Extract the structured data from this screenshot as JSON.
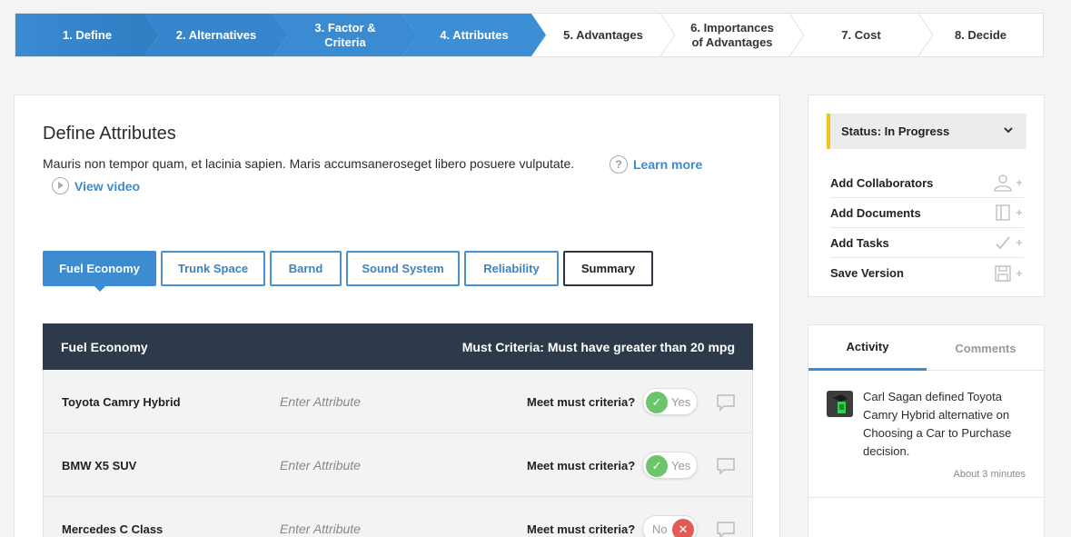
{
  "stepper": {
    "steps": [
      {
        "label": "1. Define",
        "state": "done"
      },
      {
        "label": "2. Alternatives",
        "state": "done"
      },
      {
        "label": "3. Factor &\nCriteria",
        "state": "done"
      },
      {
        "label": "4. Attributes",
        "state": "current"
      },
      {
        "label": "5. Advantages",
        "state": "todo"
      },
      {
        "label": "6. Importances\nof Advantages",
        "state": "todo"
      },
      {
        "label": "7. Cost",
        "state": "todo"
      },
      {
        "label": "8. Decide",
        "state": "todo"
      }
    ]
  },
  "main": {
    "title": "Define Attributes",
    "description": "Mauris non tempor quam, et lacinia sapien. Maris accumsaneroseget libero posuere vulputate.",
    "learn_more": "Learn more",
    "view_video": "View video",
    "tabs": [
      {
        "label": "Fuel Economy",
        "active": true
      },
      {
        "label": "Trunk Space",
        "active": false
      },
      {
        "label": "Barnd",
        "active": false
      },
      {
        "label": "Sound System",
        "active": false
      },
      {
        "label": "Reliability",
        "active": false
      },
      {
        "label": "Summary",
        "active": false
      }
    ],
    "table": {
      "factor": "Fuel Economy",
      "criteria": "Must Criteria: Must have greater than 20 mpg",
      "rows": [
        {
          "name": "Toyota Camry Hybrid",
          "placeholder": "Enter Attribute",
          "question": "Meet must criteria?",
          "toggle": "Yes",
          "state": "yes"
        },
        {
          "name": "BMW X5 SUV",
          "placeholder": "Enter Attribute",
          "question": "Meet must criteria?",
          "toggle": "Yes",
          "state": "yes"
        },
        {
          "name": "Mercedes C Class",
          "placeholder": "Enter Attribute",
          "question": "Meet must criteria?",
          "toggle": "No",
          "state": "no"
        }
      ]
    }
  },
  "status": {
    "label": "Status: In Progress",
    "accent": "#f2c418",
    "actions": [
      {
        "label": "Add Collaborators",
        "icon": "add-user-icon"
      },
      {
        "label": "Add Documents",
        "icon": "add-document-icon"
      },
      {
        "label": "Add Tasks",
        "icon": "add-task-icon"
      },
      {
        "label": "Save Version",
        "icon": "save-icon"
      }
    ]
  },
  "activity": {
    "tabs": [
      "Activity",
      "Comments"
    ],
    "feed": {
      "text": "Carl Sagan defined Toyota Camry Hybrid alternative on Choosing a Car to Purchase decision.",
      "time": "About 3 minutes"
    }
  },
  "colors": {
    "primary": "#3d8bd0",
    "header_dark": "#2e3a4b",
    "yes": "#6cc56a",
    "no": "#e45b55"
  }
}
